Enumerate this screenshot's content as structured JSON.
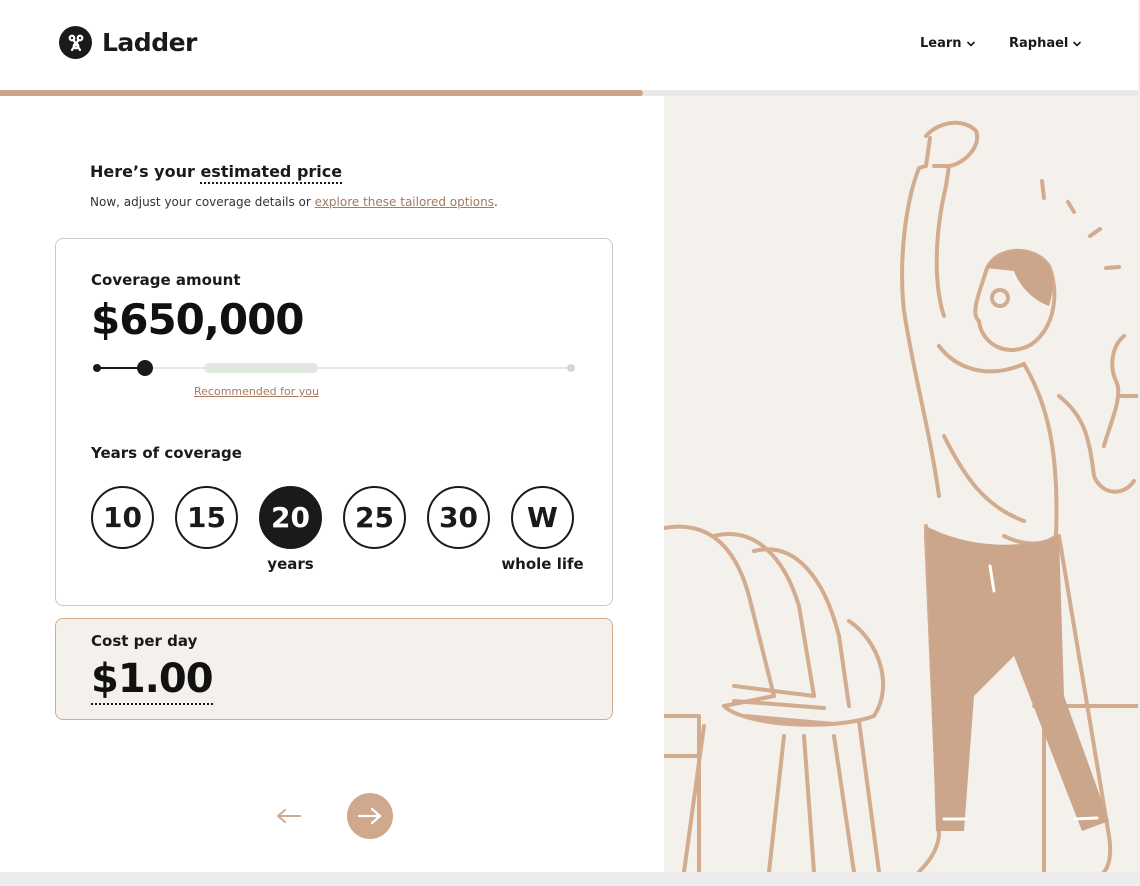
{
  "app": {
    "name": "Ladder"
  },
  "nav": {
    "learn": "Learn",
    "user": "Raphael"
  },
  "progress": {
    "fraction": 0.565
  },
  "heading": {
    "prefix": "Here’s your ",
    "emphasis": "estimated price"
  },
  "subtext": {
    "before": "Now, adjust your coverage details or ",
    "link": "explore these tailored options",
    "after": "."
  },
  "coverage": {
    "label": "Coverage amount",
    "amount": "$650,000",
    "slider_level": 0.102,
    "recommended_label": "Recommended for you"
  },
  "years": {
    "label": "Years of coverage",
    "options": [
      {
        "value": "10",
        "sub": ""
      },
      {
        "value": "15",
        "sub": ""
      },
      {
        "value": "20",
        "sub": "years",
        "selected": true
      },
      {
        "value": "25",
        "sub": ""
      },
      {
        "value": "30",
        "sub": ""
      },
      {
        "value": "W",
        "sub": "whole life"
      }
    ]
  },
  "cost": {
    "label": "Cost per day",
    "value": "$1.00"
  },
  "colors": {
    "accent": "#cfa88d",
    "link": "#a57a5f",
    "illustration_bg": "#f4f0ec",
    "illustration_line": "#d3ab8e",
    "dark": "#1a1a1a"
  },
  "icons": {
    "logo": "ladder-logo-icon",
    "chevron": "chevron-down-icon",
    "back": "arrow-left-icon",
    "next": "arrow-right-icon"
  }
}
